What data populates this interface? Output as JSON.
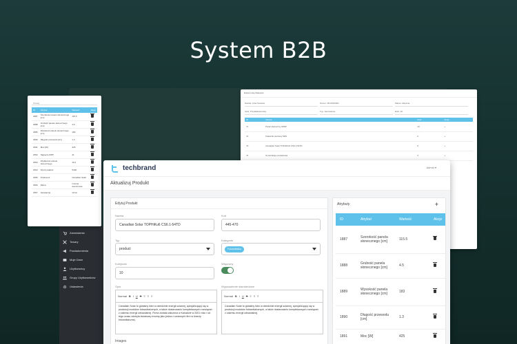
{
  "hero": {
    "title": "System B2B"
  },
  "left_window": {
    "search_label": "Szukaj",
    "columns": [
      "ID",
      "Atrybut",
      "Wartość",
      "Akcje"
    ],
    "rows": [
      {
        "id": "1887",
        "attr": "Szerokość panelu słonecznego [cm]",
        "val": "115,5"
      },
      {
        "id": "1888",
        "attr": "Grubość panelu słonecznego [cm]",
        "val": "4,5"
      },
      {
        "id": "1889",
        "attr": "Wysokość panelu słonecznego [cm]",
        "val": "183"
      },
      {
        "id": "1890",
        "attr": "Długość przewodu [cm]",
        "val": "1,3"
      },
      {
        "id": "1891",
        "attr": "Moc [W]",
        "val": "425"
      },
      {
        "id": "1892",
        "attr": "Napięcie MPP",
        "val": "41"
      },
      {
        "id": "1893",
        "attr": "Wydajność panelu słonecznego",
        "val": "19,4"
      },
      {
        "id": "1894",
        "attr": "Wytrzymałość",
        "val": "5400"
      },
      {
        "id": "1895",
        "attr": "Producent",
        "val": "Canadian Solar"
      },
      {
        "id": "1896",
        "attr": "Rama",
        "val": "Czarna aluminiowa"
      },
      {
        "id": "1897",
        "attr": "Gwarancja",
        "val": "12 lat"
      }
    ]
  },
  "right_window": {
    "title": "Edytuj Listę Zakupów",
    "fields": [
      {
        "label": "Nazwa",
        "value": "Lista Testowa"
      },
      {
        "label": "Numer",
        "value": "ZK/2023/001"
      },
      {
        "label": "Status",
        "value": "Aktywna"
      },
      {
        "label": "Opis",
        "value": "Przykładowa lista"
      },
      {
        "label": "Typ",
        "value": "zamówienie"
      },
      {
        "label": "Ilość",
        "value": "10"
      }
    ],
    "columns": [
      "ID",
      "Nazwa",
      "Ilość",
      "Akcje"
    ],
    "rows": [
      {
        "id": "71",
        "name": "Panel słoneczny 425W",
        "qty": "10"
      },
      {
        "id": "72",
        "name": "Falownik sieciowy 5kW",
        "qty": "2"
      },
      {
        "id": "73",
        "name": "Canadian Solar TOPHiKu6 CS6.1-54TD",
        "qty": "5"
      },
      {
        "id": "74",
        "name": "Konstrukcja montażowa",
        "qty": "4"
      }
    ]
  },
  "sidebar": {
    "items": [
      {
        "label": "Zamówienia",
        "icon": "cart-icon"
      },
      {
        "label": "Towary",
        "icon": "tools-icon"
      },
      {
        "label": "Powiadomienia",
        "icon": "megaphone-icon"
      },
      {
        "label": "Moje Dane",
        "icon": "id-card-icon"
      },
      {
        "label": "Użytkownicy",
        "icon": "user-icon"
      },
      {
        "label": "Grupy Użytkowników",
        "icon": "users-icon"
      },
      {
        "label": "Ustawienia",
        "icon": "gear-icon"
      }
    ]
  },
  "main": {
    "brand": "techbrand",
    "user_menu": "Admin",
    "page_title": "Aktualizuj Produkt",
    "edit_card": {
      "title": "Edytuj Produkt",
      "name_label": "Nazwa",
      "name_value": "Canadian Solar TOPHiKu6 CS6.1-54TD",
      "code_label": "Kod",
      "code_value": "445-470",
      "type_label": "Typ",
      "type_value": "product",
      "category_label": "Kategorie",
      "category_chip": "Fotowoltaika",
      "order_label": "Kolejność",
      "order_value": "10",
      "enabled_label": "Włączony",
      "enabled": true,
      "desc_label": "Opis",
      "std_label": "Wyposażenie standardowe",
      "toolbar": [
        "Normal",
        "B",
        "I",
        "U",
        "S",
        "≡",
        "≡",
        "≡"
      ],
      "desc_text": "Canadian Solar to globalny lider w dziedzinie energii solarnej, specjalizujący się w produkcji modułów fotowoltaicznych, a także dostarczaniu kompleksowych rozwiązań z zakresu energii odnawialnej. Firma została założona w Kanadzie w 2001 roku i od tego czasu zdobyła światową renomę jako jedna z czołowych firm w branży fotowoltaicznej.",
      "std_text": "Canadian Solar to globalny lider w dziedzinie energii solarnej, specjalizujący się w produkcji modułów fotowoltaicznych, a także dostarczaniu kompleksowych rozwiązań z zakresu energii odnawialnej.",
      "images_label": "Images"
    },
    "attr_card": {
      "title": "Atrybuty",
      "columns": [
        "ID",
        "Atrybut",
        "Wartość",
        "Akcje"
      ],
      "rows": [
        {
          "id": "1887",
          "attr": "Szerokość panela słonecznego [cm]",
          "val": "115.5"
        },
        {
          "id": "1888",
          "attr": "Grubość panela słonecznego [cm]",
          "val": "4.5"
        },
        {
          "id": "1889",
          "attr": "Wysokość panela słonecznego [cm]",
          "val": "183"
        },
        {
          "id": "1890",
          "attr": "Długość przewodu [cm]",
          "val": "1.3"
        },
        {
          "id": "1891",
          "attr": "Moc [W]",
          "val": "425"
        }
      ]
    }
  },
  "colors": {
    "accent": "#5ec1ea",
    "toggle": "#4a8a5c",
    "brand": "#2b3a55",
    "bg_dark": "#163230"
  }
}
